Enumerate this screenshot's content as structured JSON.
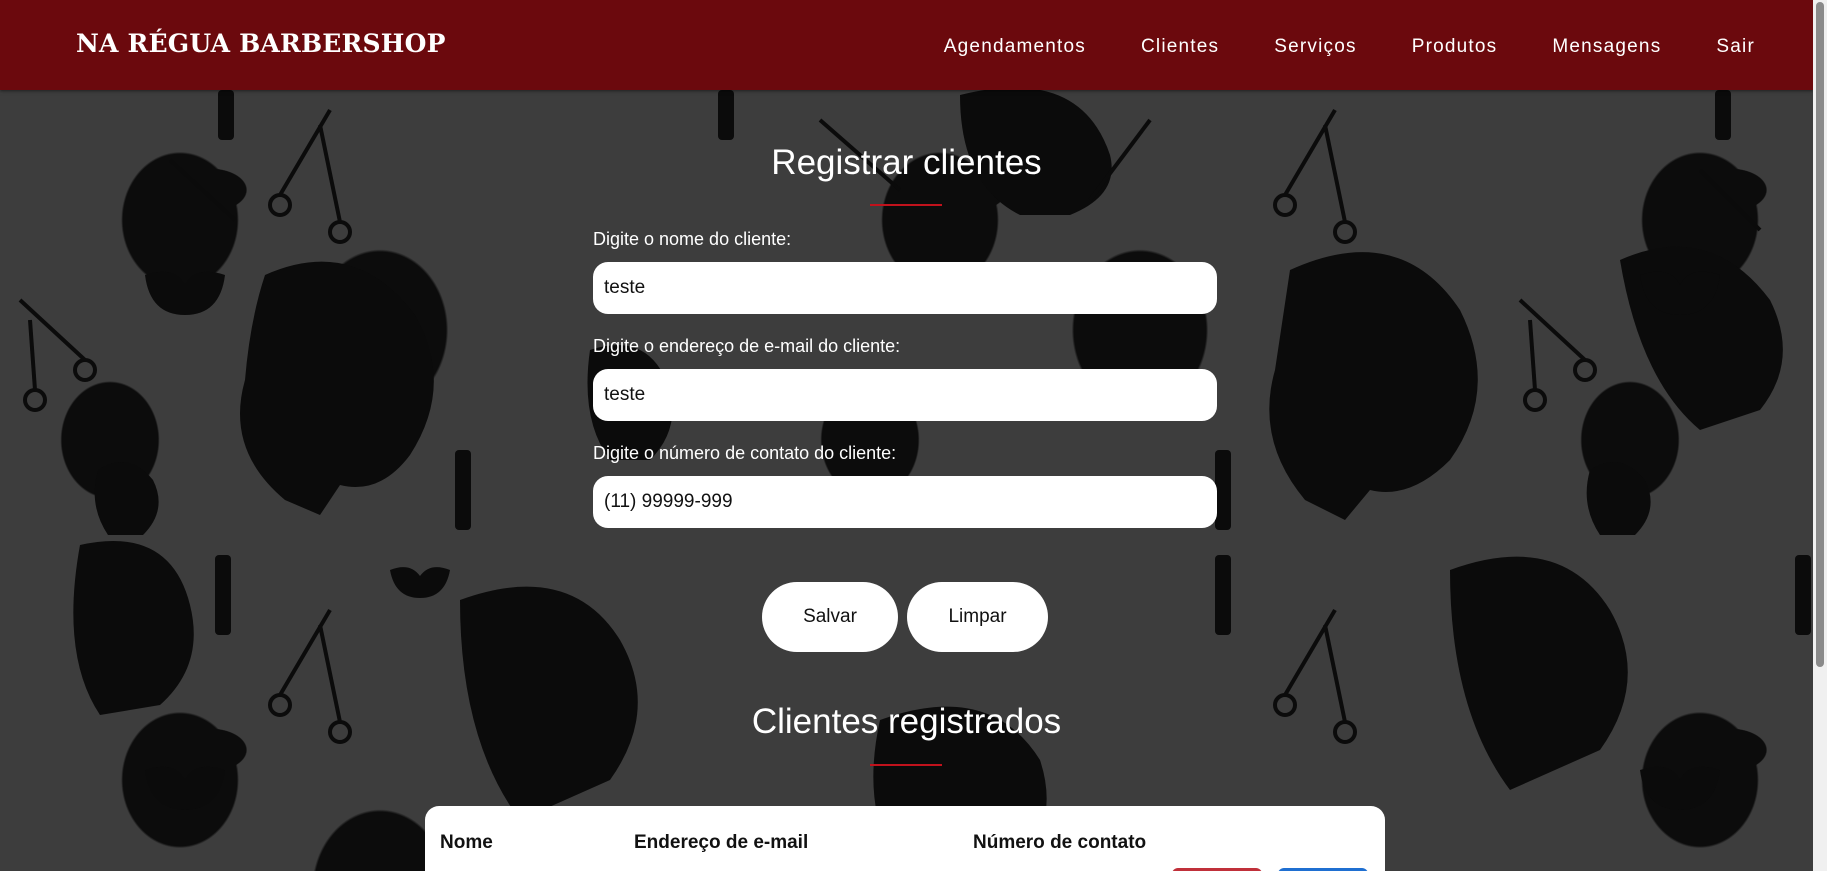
{
  "header": {
    "brand": "NA RÉGUA BARBERSHOP",
    "nav": [
      "Agendamentos",
      "Clientes",
      "Serviços",
      "Produtos",
      "Mensagens",
      "Sair"
    ]
  },
  "register": {
    "title": "Registrar clientes",
    "name_label": "Digite o nome do cliente:",
    "name_value": "teste",
    "email_label": "Digite o endereço de e-mail do cliente:",
    "email_value": "teste",
    "phone_label": "Digite o número de contato do cliente:",
    "phone_value": "(11) 99999-999",
    "save_label": "Salvar",
    "clear_label": "Limpar"
  },
  "registered": {
    "title": "Clientes registrados",
    "columns": [
      "Nome",
      "Endereço de e-mail",
      "Número de contato"
    ]
  },
  "colors": {
    "header_bg": "#6b090d",
    "accent": "#c1121c",
    "page_bg": "#3d3d3d",
    "delete_chip": "#c0303a",
    "edit_chip": "#1f6fd1"
  }
}
